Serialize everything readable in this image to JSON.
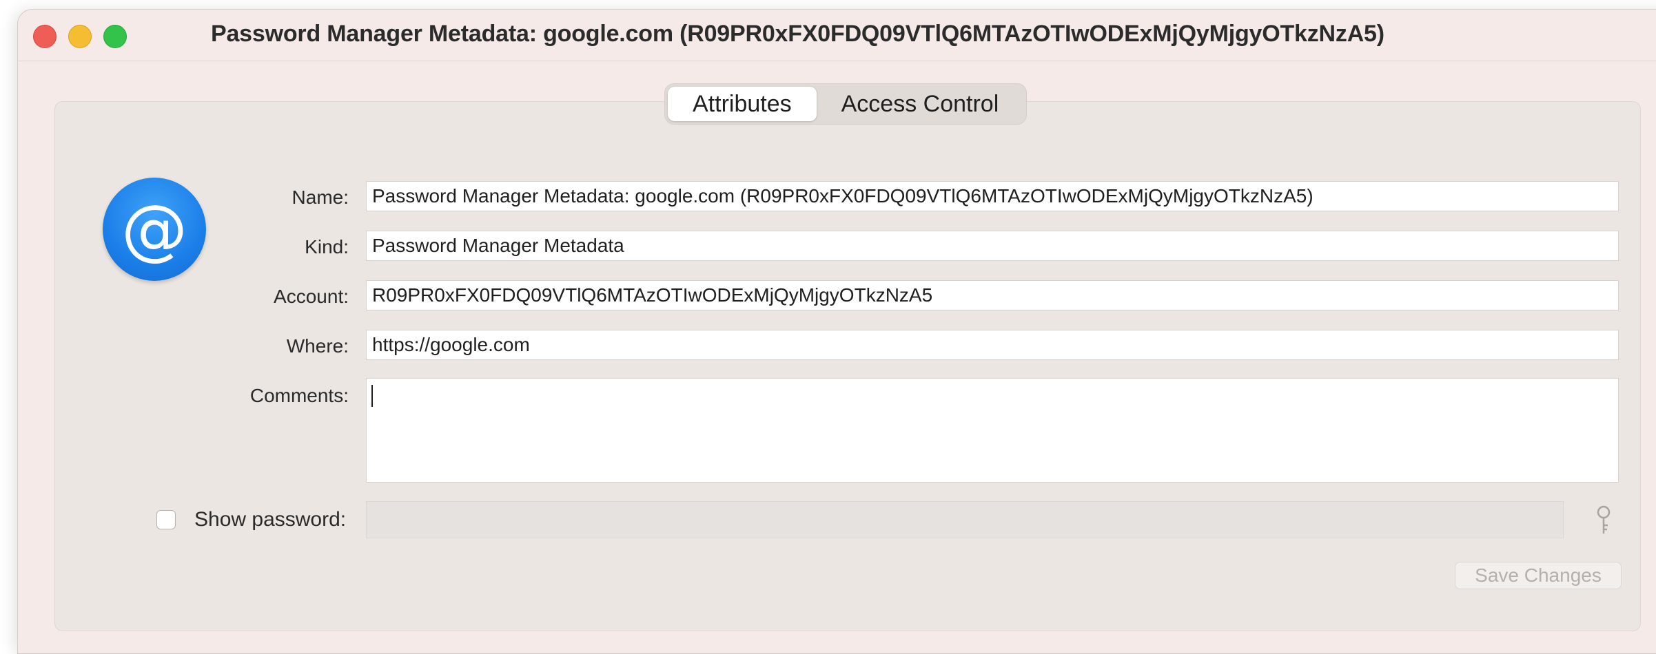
{
  "window": {
    "title": "Password Manager Metadata: google.com (R09PR0xFX0FDQ09VTlQ6MTAzOTIwODExMjQyMjgyOTkzNzA5)"
  },
  "tabs": [
    {
      "label": "Attributes",
      "active": true
    },
    {
      "label": "Access Control",
      "active": false
    }
  ],
  "item": {
    "icon": "at-sign-icon",
    "icon_glyph": "@"
  },
  "fields": {
    "name": {
      "label": "Name:",
      "value": "Password Manager Metadata: google.com (R09PR0xFX0FDQ09VTlQ6MTAzOTIwODExMjQyMjgyOTkzNzA5)"
    },
    "kind": {
      "label": "Kind:",
      "value": "Password Manager Metadata"
    },
    "account": {
      "label": "Account:",
      "value": "R09PR0xFX0FDQ09VTlQ6MTAzOTIwODExMjQyMjgyOTkzNzA5"
    },
    "where": {
      "label": "Where:",
      "value": "https://google.com"
    },
    "comments": {
      "label": "Comments:",
      "value": ""
    }
  },
  "password": {
    "checkbox_label": "Show password:",
    "checked": false,
    "value": "",
    "key_icon": "key-icon"
  },
  "actions": {
    "save_label": "Save Changes",
    "save_enabled": false
  },
  "colors": {
    "close": "#ee5d56",
    "minimize": "#f5bd32",
    "zoom": "#33c24a",
    "icon_blue": "#1b7fe9"
  }
}
